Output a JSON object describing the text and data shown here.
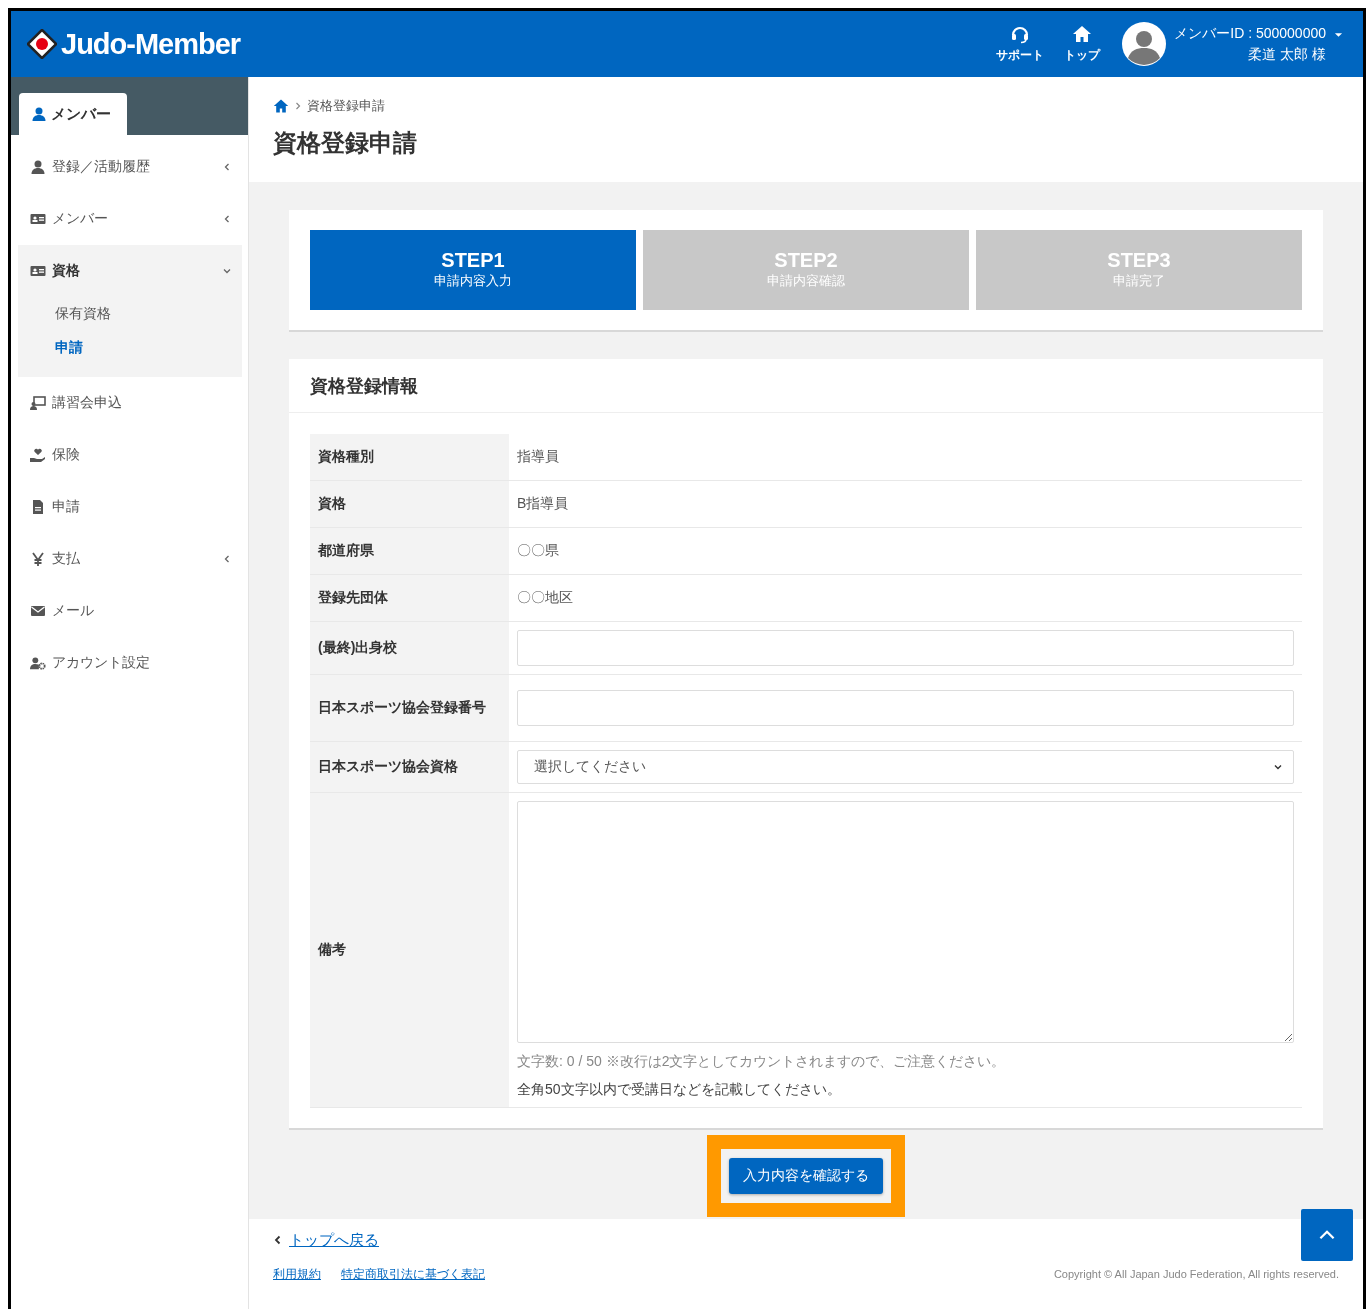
{
  "header": {
    "logo_text": "Judo-Member",
    "nav": [
      {
        "kind": "support",
        "label": "サポート"
      },
      {
        "kind": "home",
        "label": "トップ"
      }
    ],
    "user": {
      "id_label": "メンバーID : 500000000",
      "name": "柔道 太郎 様"
    }
  },
  "sidebar": {
    "tab_label": "メンバー",
    "items": [
      {
        "kind": "person",
        "label": "登録／活動履歴",
        "expandable": true,
        "expanded": false
      },
      {
        "kind": "card",
        "label": "メンバー",
        "expandable": true,
        "expanded": false
      },
      {
        "kind": "card",
        "label": "資格",
        "expandable": true,
        "expanded": true,
        "children": [
          {
            "label": "保有資格",
            "selected": false
          },
          {
            "label": "申請",
            "selected": true
          }
        ]
      },
      {
        "kind": "lecture",
        "label": "講習会申込",
        "expandable": false,
        "expanded": false
      },
      {
        "kind": "insurance",
        "label": "保険",
        "expandable": false,
        "expanded": false
      },
      {
        "kind": "file",
        "label": "申請",
        "expandable": false,
        "expanded": false
      },
      {
        "kind": "yen",
        "label": "支払",
        "expandable": true,
        "expanded": false
      },
      {
        "kind": "mail",
        "label": "メール",
        "expandable": false,
        "expanded": false
      },
      {
        "kind": "account",
        "label": "アカウント設定",
        "expandable": false,
        "expanded": false
      }
    ]
  },
  "breadcrumb": [
    "資格登録申請"
  ],
  "title": "資格登録申請",
  "steps": [
    {
      "title": "STEP1",
      "subtitle": "申請内容入力",
      "selected": true
    },
    {
      "title": "STEP2",
      "subtitle": "申請内容確認",
      "selected": false
    },
    {
      "title": "STEP3",
      "subtitle": "申請完了",
      "selected": false
    }
  ],
  "section_title": "資格登録情報",
  "fields": [
    {
      "kind": "text",
      "label": "資格種別",
      "value": "指導員"
    },
    {
      "kind": "text",
      "label": "資格",
      "value": "B指導員"
    },
    {
      "kind": "text",
      "label": "都道府県",
      "value": "〇〇県"
    },
    {
      "kind": "text",
      "label": "登録先団体",
      "value": "〇〇地区"
    },
    {
      "kind": "input",
      "label": "(最終)出身校"
    },
    {
      "kind": "input",
      "label": "日本スポーツ協会登録番号"
    },
    {
      "kind": "select",
      "label": "日本スポーツ協会資格",
      "value": "選択してください"
    },
    {
      "kind": "textarea",
      "label": "備考",
      "counter": "文字数: 0 / 50 ※改行は2文字としてカウントされますので、ご注意ください。",
      "note": "全角50文字以内で受講日などを記載してください。"
    }
  ],
  "submit_button": {
    "label": "入力内容を確認する",
    "highlighted": true
  },
  "footer": {
    "back_link": "トップへ戻る",
    "links": [
      "利用規約",
      "特定商取引法に基づく表記"
    ],
    "copyright": "Copyright © All Japan Judo Federation, All rights reserved."
  }
}
